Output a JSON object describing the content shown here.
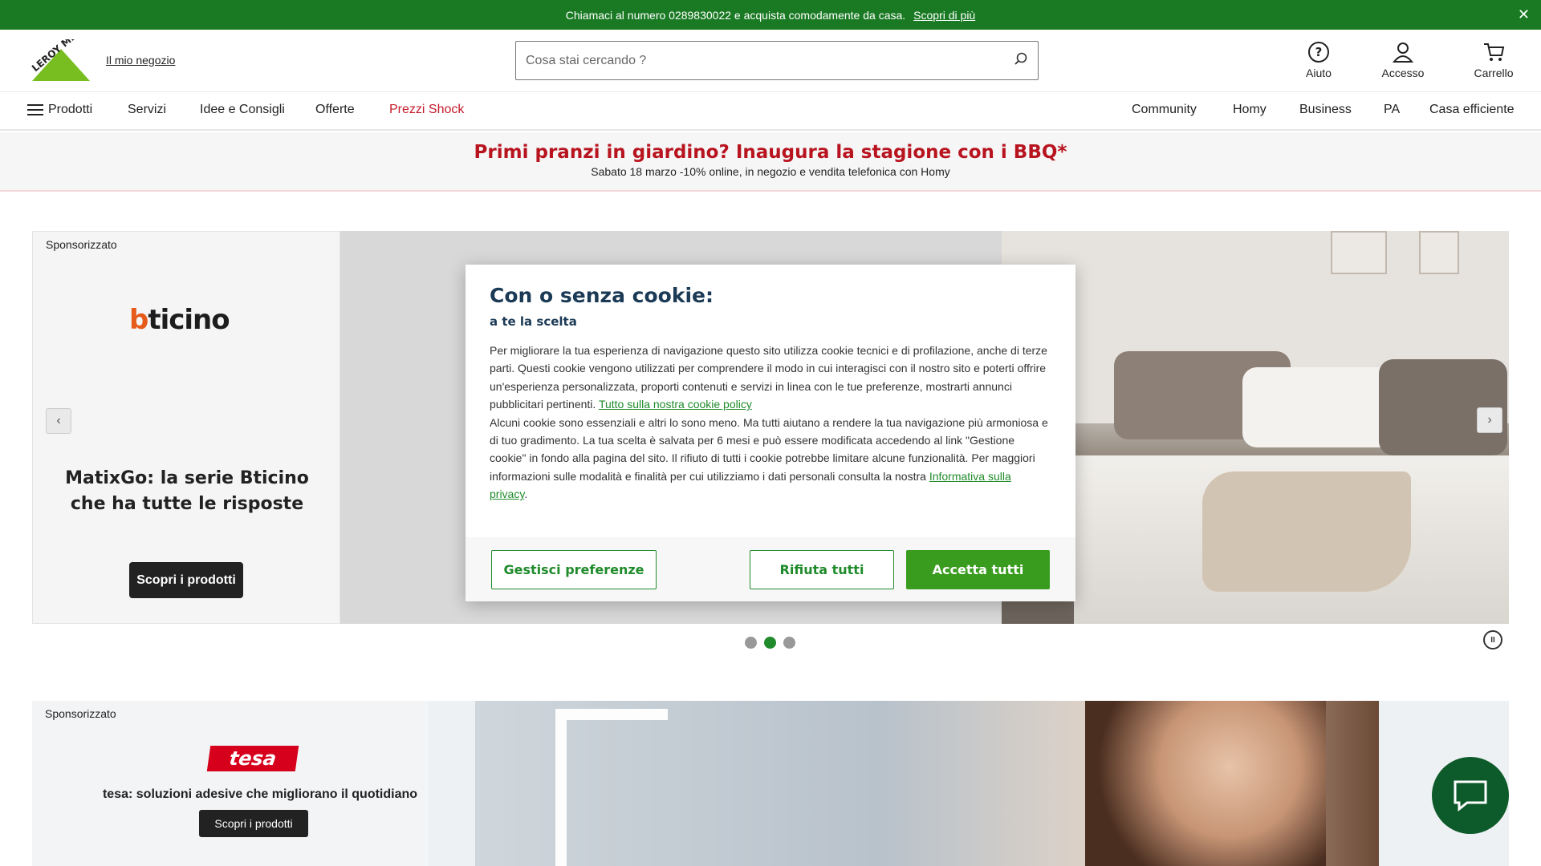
{
  "topbar": {
    "message": "Chiamaci al numero 0289830022 e acquista comodamente da casa.",
    "link": "Scopri di più",
    "close": "✕"
  },
  "header": {
    "logo_text": "LEROY MERLIN",
    "store_link": "Il mio negozio",
    "search_placeholder": "Cosa stai cercando ?",
    "help": "Aiuto",
    "login": "Accesso",
    "cart": "Carrello"
  },
  "nav": {
    "left": [
      "Prodotti",
      "Servizi",
      "Idee e Consigli",
      "Offerte",
      "Prezzi Shock"
    ],
    "right": [
      "Community",
      "Homy",
      "Business",
      "PA",
      "Casa efficiente"
    ]
  },
  "promo": {
    "title": "Primi pranzi in giardino? Inaugura la stagione con i BBQ*",
    "subtitle": "Sabato 18 marzo -10% online, in negozio e vendita telefonica con Homy"
  },
  "carousel": {
    "sponsor": "Sponsorizzato",
    "brand": "bticino",
    "title": "MatixGo: la serie Bticino che ha tutte le risposte",
    "button": "Scopri i prodotti",
    "prev": "‹",
    "next": "›",
    "active_index": 1,
    "dot_count": 3
  },
  "banner2": {
    "sponsor": "Sponsorizzato",
    "brand": "tesa",
    "text": "tesa: soluzioni adesive che migliorano il quotidiano",
    "button": "Scopri i prodotti"
  },
  "cookie": {
    "title": "Con o senza cookie:",
    "subtitle": "a te la scelta",
    "body1": "Per migliorare la tua esperienza di navigazione questo sito utilizza cookie tecnici e di profilazione, anche di terze parti. Questi cookie vengono utilizzati per comprendere il modo in cui interagisci con il nostro sito e poterti offrire un'esperienza personalizzata, proporti contenuti e servizi in linea con le tue preferenze, mostrarti annunci pubblicitari pertinenti.",
    "link1": "Tutto sulla nostra cookie policy",
    "body2": "Alcuni cookie sono essenziali e altri lo sono meno. Ma tutti aiutano a rendere la tua navigazione più armoniosa e di tuo gradimento. La tua scelta è salvata per 6 mesi e può essere modificata accedendo al link \"Gestione cookie\" in fondo alla pagina del sito. Il rifiuto di tutti i cookie potrebbe limitare alcune funzionalità. Per maggiori informazioni sulle modalità e finalità per cui utilizziamo i dati personali consulta la nostra",
    "link2": "Informativa sulla privacy",
    "period": ".",
    "manage": "Gestisci preferenze",
    "reject": "Rifiuta tutti",
    "accept": "Accetta tutti"
  },
  "colors": {
    "brand_green": "#1a7a24",
    "accent_green": "#3a9c1f",
    "promo_red": "#b8141f",
    "chat_green": "#0d5a2a"
  }
}
